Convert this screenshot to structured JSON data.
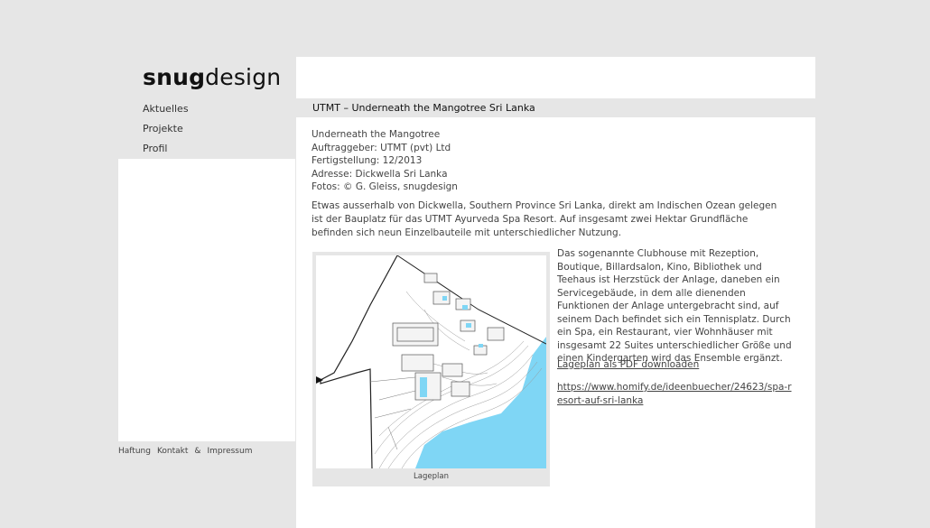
{
  "logo": {
    "bold": "snug",
    "light": "design"
  },
  "nav": {
    "items": [
      {
        "label": "Aktuelles"
      },
      {
        "label": "Projekte"
      },
      {
        "label": "Profil"
      }
    ]
  },
  "footer": {
    "haftung": "Haftung",
    "kontakt": "Kontakt",
    "amp": "&",
    "impressum": "Impressum"
  },
  "page": {
    "title": "UTMT – Underneath the Mangotree Sri Lanka",
    "facts": [
      "Underneath the Mangotree",
      "Auftraggeber: UTMT (pvt) Ltd",
      "Fertigstellung: 12/2013",
      "Adresse: Dickwella Sri Lanka",
      "Fotos: © G. Gleiss, snugdesign"
    ],
    "intro": "Etwas ausserhalb von Dickwella, Southern Province Sri Lanka, direkt am Indischen Ozean gelegen ist der Bauplatz für das UTMT Ayurveda Spa Resort. Auf insgesamt zwei Hektar Grundfläche befinden sich neun Einzelbauteile mit unterschiedlicher Nutzung.",
    "description": "Das sogenannte Clubhouse mit Rezeption, Boutique, Billardsalon, Kino, Bibliothek und Teehaus ist Herzstück der Anlage, daneben ein Servicegebäude, in dem alle dienenden Funktionen der Anlage untergebracht sind, auf seinem Dach befindet sich ein Tennisplatz. Durch ein Spa, ein Restaurant, vier Wohnhäuser mit insgesamt 22 Suites unterschiedlicher Größe und einen Kindergarten wird das Ensemble ergänzt.",
    "pdf_link": "Lageplan als PDF downloaden",
    "homify_link": "https://www.homify.de/ideenbuecher/24623/spa-resort-auf-sri-lanka",
    "figure_caption": "Lageplan"
  },
  "colors": {
    "background": "#e6e6e6",
    "panel": "#ffffff",
    "water": "#7fd6f5"
  }
}
